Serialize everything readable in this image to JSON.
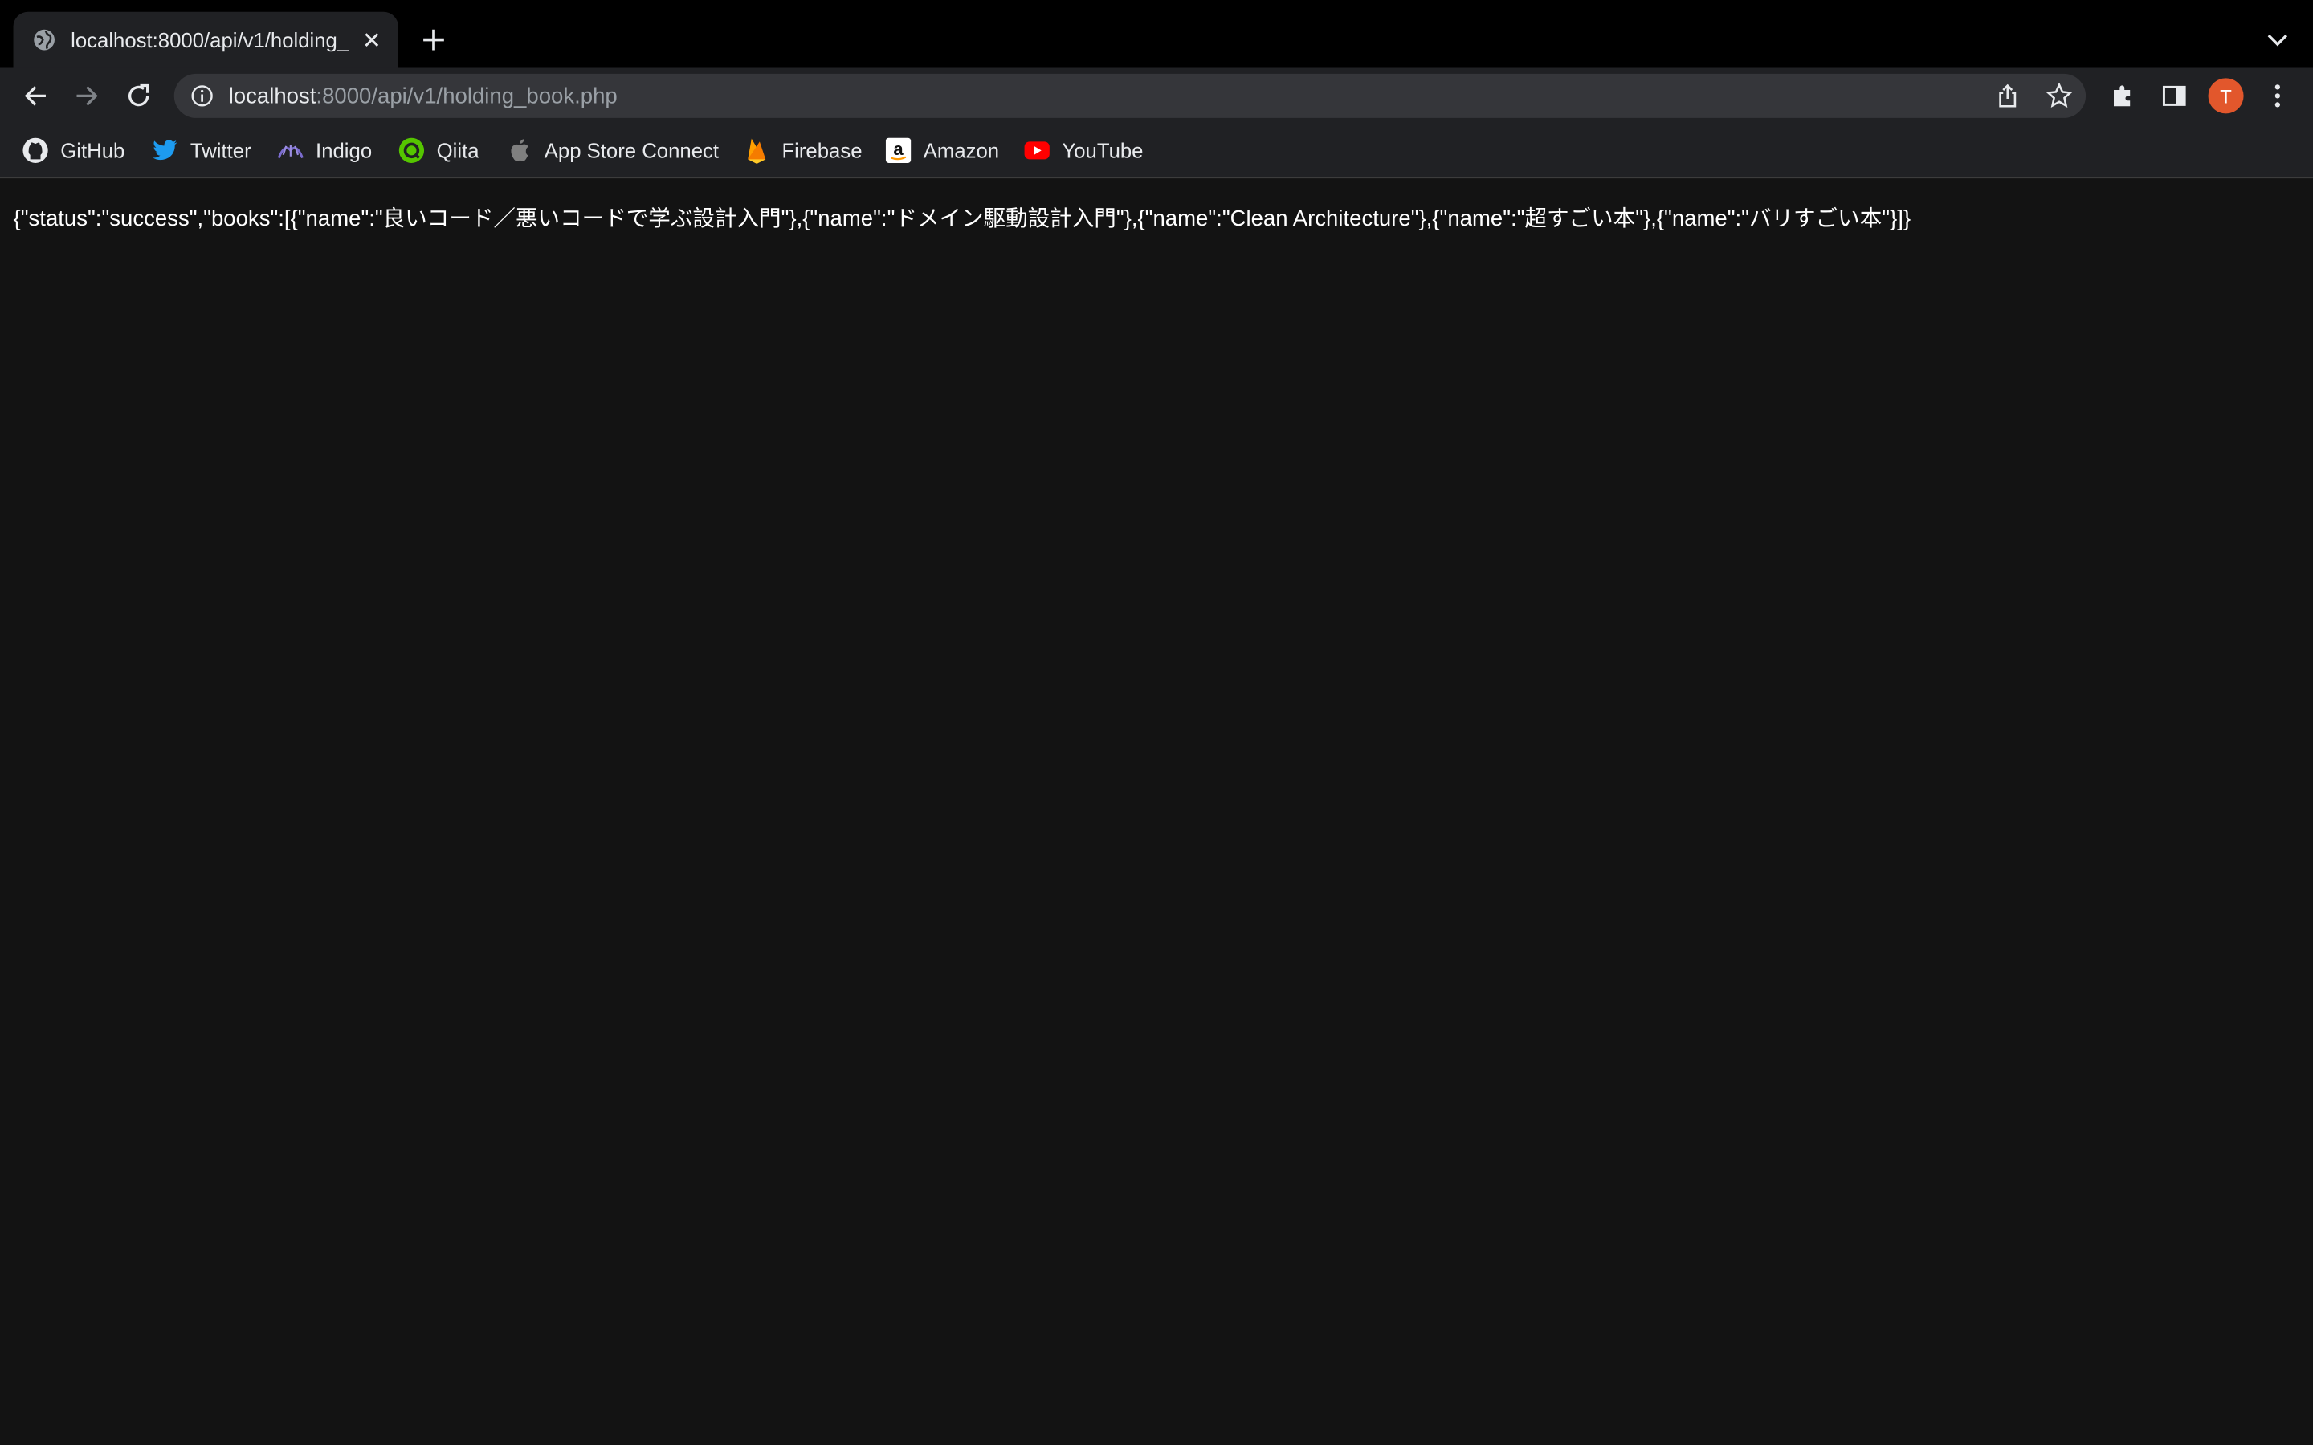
{
  "tab": {
    "title": "localhost:8000/api/v1/holding_"
  },
  "address_bar": {
    "host": "localhost",
    "path": ":8000/api/v1/holding_book.php"
  },
  "profile": {
    "initial": "T",
    "color": "#e2572c"
  },
  "bookmarks": [
    {
      "label": "GitHub",
      "icon": "github-icon"
    },
    {
      "label": "Twitter",
      "icon": "twitter-icon"
    },
    {
      "label": "Indigo",
      "icon": "indigo-icon"
    },
    {
      "label": "Qiita",
      "icon": "qiita-icon"
    },
    {
      "label": "App Store Connect",
      "icon": "apple-icon"
    },
    {
      "label": "Firebase",
      "icon": "firebase-icon"
    },
    {
      "label": "Amazon",
      "icon": "amazon-icon"
    },
    {
      "label": "YouTube",
      "icon": "youtube-icon"
    }
  ],
  "page": {
    "body_text": "{\"status\":\"success\",\"books\":[{\"name\":\"良いコード／悪いコードで学ぶ設計入門\"},{\"name\":\"ドメイン駆動設計入門\"},{\"name\":\"Clean Architecture\"},{\"name\":\"超すごい本\"},{\"name\":\"バリすごい本\"}]}"
  },
  "colors": {
    "background": "#131313",
    "toolbar": "#202124",
    "tabstrip": "#000000"
  }
}
